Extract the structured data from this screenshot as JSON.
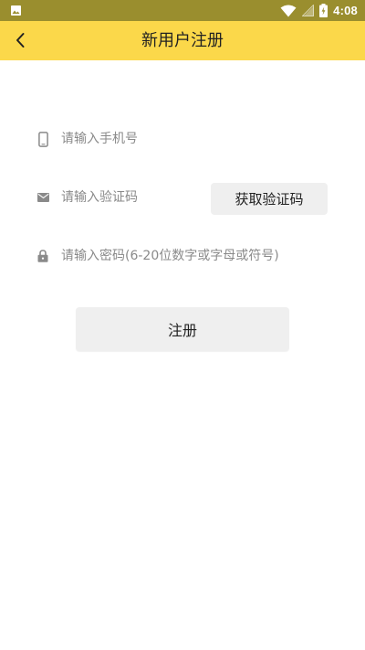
{
  "status_bar": {
    "time": "4:08",
    "icons": [
      "image-icon",
      "wifi-icon",
      "signal-icon",
      "battery-charging-icon"
    ]
  },
  "app_bar": {
    "title": "新用户注册",
    "back_icon": "back-arrow-icon",
    "background": "#fbd84a"
  },
  "form": {
    "phone": {
      "icon": "phone-icon",
      "value": "",
      "placeholder": "请输入手机号"
    },
    "code": {
      "icon": "mail-icon",
      "value": "",
      "placeholder": "请输入验证码",
      "button_label": "获取验证码"
    },
    "password": {
      "icon": "lock-icon",
      "value": "",
      "placeholder": "请输入密码(6-20位数字或字母或符号)"
    },
    "submit_label": "注册"
  }
}
